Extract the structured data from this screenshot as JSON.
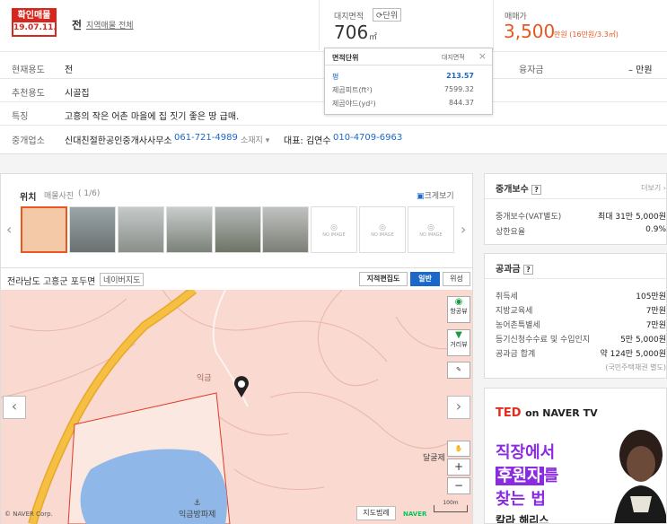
{
  "header": {
    "stamp_line1": "확인매물",
    "stamp_line2": "19.07.11.",
    "type": "전",
    "all_link": "지역매물 전체",
    "area_label": "대지면적",
    "unit_button": "단위",
    "area_value": "706",
    "area_unit": "㎡",
    "price_label": "매매가",
    "price_value": "3,500",
    "price_unit": "만원 (16만원/3.3㎡)"
  },
  "info": {
    "current_use_label": "현재용도",
    "current_use": "전",
    "recommend_label": "추천용도",
    "recommend": "시골집",
    "feature_label": "특징",
    "feature": "고흥의 작은 어촌 마을에 집 짓기 좋은 땅 급매.",
    "agent_label": "중개업소",
    "agent_name": "신대친절한공인중개사사무소",
    "agent_phone": "061-721-4989",
    "agent_addr": "소재지",
    "rep_label": "대표: 김연수",
    "rep_phone": "010-4709-6963",
    "loan_label": "융자금",
    "loan_value": "– 만원"
  },
  "unit_popup": {
    "title": "면적단위",
    "subtitle": "대지면적",
    "rows": [
      {
        "unit": "평",
        "value": "213.57"
      },
      {
        "unit": "제곱피트(ft²)",
        "value": "7599.32"
      },
      {
        "unit": "제곱야드(yd²)",
        "value": "844.37"
      }
    ]
  },
  "map": {
    "tab_location": "위치",
    "tab_photos": "매물사진",
    "photo_count": "( 1/6)",
    "enlarge": "크게보기",
    "no_image": "NO IMAGE",
    "address": "전라남도 고흥군 포두면",
    "naver_map": "네이버지도",
    "cadastral": "지적편집도",
    "normal": "일반",
    "satellite": "위성",
    "ctl_aerial": "항공뷰",
    "ctl_street": "거리뷰",
    "label_iggeum": "익금",
    "label_dalgeulje": "달굴제",
    "label_beach": "익금방파제",
    "copyright": "© NAVER Corp.",
    "legend": "지도범례",
    "naver": "NAVER",
    "scale": "100m"
  },
  "fee": {
    "title": "중개보수",
    "more": "더보기",
    "rows": [
      {
        "label": "중개보수(VAT별도)",
        "value": "최대 31만 5,000원"
      },
      {
        "label": "상한요율",
        "value": "0.9%"
      }
    ]
  },
  "tax": {
    "title": "공과금",
    "rows": [
      {
        "label": "취득세",
        "value": "105만원"
      },
      {
        "label": "지방교육세",
        "value": "7만원"
      },
      {
        "label": "농어촌특별세",
        "value": "7만원"
      },
      {
        "label": "등기신청수수료 및 수입인지",
        "value": "5만 5,000원"
      },
      {
        "label": "공과금 합계",
        "value": "약 124만 5,000원"
      }
    ],
    "note": "(국민주택채권 별도)"
  },
  "ad": {
    "brand": "TED",
    "on": "on NAVER TV",
    "line1": "직장에서",
    "line2": "후원자",
    "line2b": "를",
    "line3": "찾는 법",
    "line4": "칼라 해리스"
  },
  "colors": {
    "accent": "#1a68c9",
    "price": "#e8571f",
    "stamp": "#d7261e",
    "map_bg": "#f9d9d0"
  }
}
